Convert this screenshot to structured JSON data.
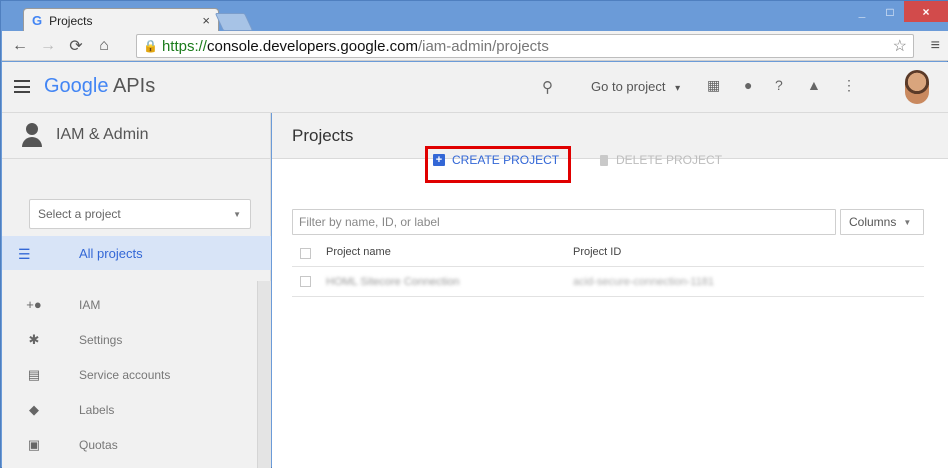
{
  "browser": {
    "tab_title": "Projects",
    "tab_icon": "G",
    "tab_close": "×",
    "url_scheme": "https://",
    "url_host": "console.developers.google.com",
    "url_path": "/iam-admin/projects",
    "win_min": "_",
    "win_max": "□",
    "win_close": "×"
  },
  "header": {
    "logo_google": "Google",
    "logo_apis": " APIs",
    "go_to_project": "Go to project",
    "caret": "▾"
  },
  "sidebar": {
    "title": "IAM & Admin",
    "project_select_placeholder": "Select a project",
    "active_item": "All projects",
    "items": [
      {
        "label": "IAM",
        "icon": "add-person-icon"
      },
      {
        "label": "Settings",
        "icon": "gear-icon"
      },
      {
        "label": "Service accounts",
        "icon": "service-account-icon"
      },
      {
        "label": "Labels",
        "icon": "tag-icon"
      },
      {
        "label": "Quotas",
        "icon": "quota-icon"
      }
    ]
  },
  "main": {
    "title": "Projects",
    "create_project": "CREATE PROJECT",
    "delete_project": "DELETE PROJECT",
    "filter_placeholder": "Filter by name, ID, or label",
    "columns_button": "Columns",
    "table": {
      "headers": [
        "Project name",
        "Project ID"
      ],
      "rows": [
        [
          "HOML Sitecore Connection",
          "acid-secure-connection-1181"
        ]
      ]
    }
  },
  "colors": {
    "accent": "#3367d6",
    "highlight_box": "#e00000",
    "chrome_frame": "#6b9bd8"
  }
}
